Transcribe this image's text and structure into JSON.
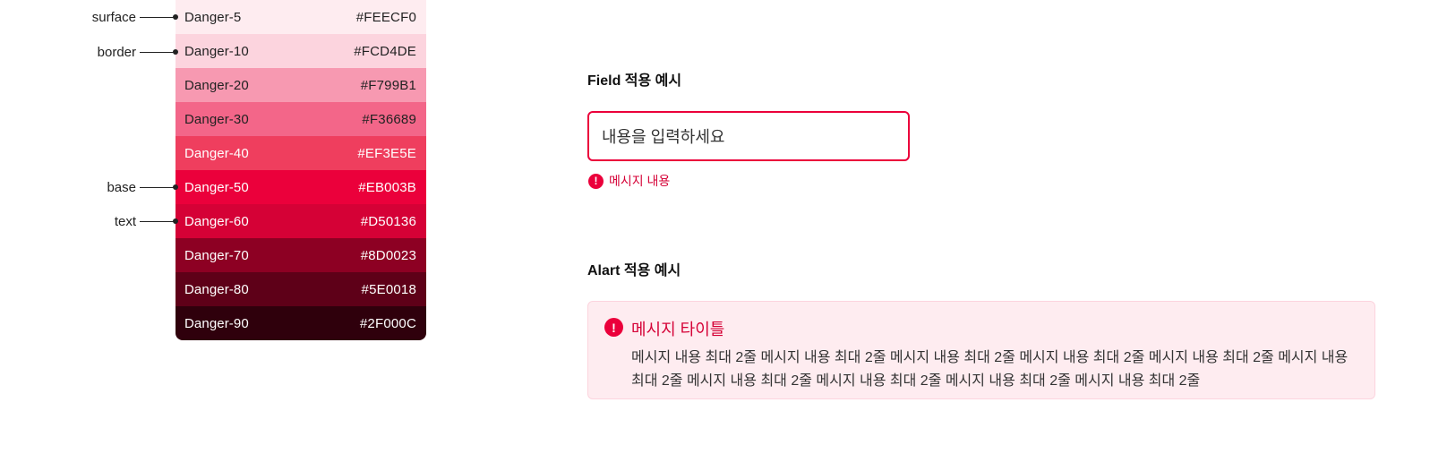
{
  "palette": {
    "swatches": [
      {
        "name": "Danger-5",
        "hex": "#FEECF0",
        "text_color": "#222222"
      },
      {
        "name": "Danger-10",
        "hex": "#FCD4DE",
        "text_color": "#222222"
      },
      {
        "name": "Danger-20",
        "hex": "#F799B1",
        "text_color": "#222222"
      },
      {
        "name": "Danger-30",
        "hex": "#F36689",
        "text_color": "#222222"
      },
      {
        "name": "Danger-40",
        "hex": "#EF3E5E",
        "text_color": "#FFFFFF"
      },
      {
        "name": "Danger-50",
        "hex": "#EB003B",
        "text_color": "#FFFFFF"
      },
      {
        "name": "Danger-60",
        "hex": "#D50136",
        "text_color": "#FFFFFF"
      },
      {
        "name": "Danger-70",
        "hex": "#8D0023",
        "text_color": "#FFFFFF"
      },
      {
        "name": "Danger-80",
        "hex": "#5E0018",
        "text_color": "#FFFFFF"
      },
      {
        "name": "Danger-90",
        "hex": "#2F000C",
        "text_color": "#FFFFFF"
      }
    ]
  },
  "callouts": {
    "surface": "surface",
    "border": "border",
    "base": "base",
    "text": "text"
  },
  "field_example": {
    "title": "Field  적용 예시",
    "input_value": "내용을 입력하세요",
    "error_icon": "!",
    "error_message": "메시지 내용"
  },
  "alert_example": {
    "title": "Alart 적용 예시",
    "icon": "!",
    "message_title": "메시지 타이틀",
    "message_body": "메시지 내용 최대 2줄 메시지 내용 최대 2줄 메시지 내용 최대 2줄 메시지 내용 최대 2줄 메시지 내용 최대 2줄 메시지 내용 최대 2줄 메시지 내용 최대 2줄 메시지 내용 최대 2줄 메시지 내용 최대 2줄 메시지 내용 최대 2줄"
  }
}
